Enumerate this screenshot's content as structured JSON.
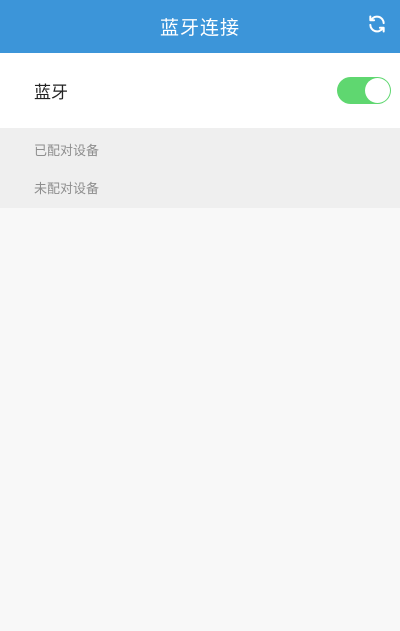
{
  "header": {
    "title": "蓝牙连接",
    "refresh_icon": "refresh-icon",
    "background_color": "#3c95d9"
  },
  "bluetooth": {
    "label": "蓝牙",
    "enabled": true,
    "toggle_color": "#5fd770"
  },
  "sections": {
    "paired": "已配对设备",
    "unpaired": "未配对设备"
  }
}
